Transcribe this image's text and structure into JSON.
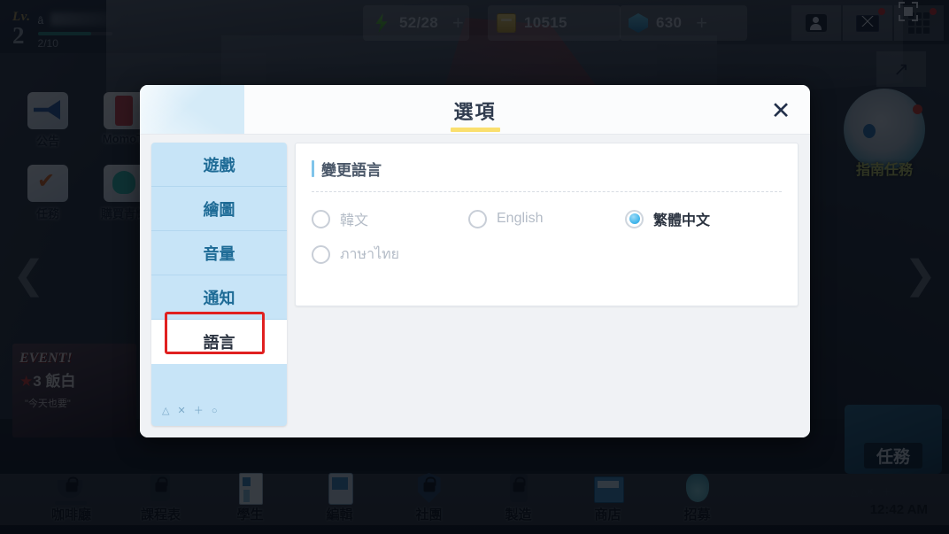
{
  "hud": {
    "level_label": "Lv.",
    "level_value": "2",
    "xp_text": "2/10",
    "currencies": [
      {
        "icon": "energy-icon",
        "value": "52/28",
        "plus": "+"
      },
      {
        "icon": "coin-icon",
        "value": "10515",
        "plus": ""
      },
      {
        "icon": "gem-icon",
        "value": "630",
        "plus": "+"
      }
    ],
    "right_buttons": [
      {
        "name": "friends-icon"
      },
      {
        "name": "mail-icon"
      },
      {
        "name": "menu-grid-icon"
      }
    ],
    "expand_icon": "↗"
  },
  "side_menu": {
    "items": [
      {
        "label": "公告",
        "icon": "announcement-icon"
      },
      {
        "label": "MomoT.",
        "icon": "momotalk-icon"
      },
      {
        "label": "任務",
        "icon": "mission-icon"
      },
      {
        "label": "購買青輝",
        "icon": "shop-pyroxene-icon"
      }
    ]
  },
  "character": {
    "label": "指南任務"
  },
  "nav": {
    "left_arrow": "❮",
    "right_arrow": "❯"
  },
  "event_banner": {
    "title": "EVENT!",
    "star": "★",
    "subtitle": "3 飯白",
    "small": "\"今天也要\""
  },
  "task_button": {
    "label": "任務"
  },
  "bottom_nav": {
    "items": [
      {
        "label": "咖啡廳",
        "icon": "cafe-icon",
        "locked": true
      },
      {
        "label": "課程表",
        "icon": "schedule-icon",
        "locked": true
      },
      {
        "label": "學生",
        "icon": "students-icon",
        "locked": false
      },
      {
        "label": "編輯",
        "icon": "edit-icon",
        "locked": false
      },
      {
        "label": "社團",
        "icon": "club-icon",
        "locked": true
      },
      {
        "label": "製造",
        "icon": "craft-icon",
        "locked": true
      },
      {
        "label": "商店",
        "icon": "shop-icon",
        "locked": false
      },
      {
        "label": "招募",
        "icon": "recruit-icon",
        "locked": false
      }
    ],
    "ps_glyphs": "△ ✕ ＋ ○",
    "clock": "12:42 AM"
  },
  "dialog": {
    "title": "選項",
    "close_label": "✕",
    "tabs": [
      {
        "label": "遊戲",
        "active": false
      },
      {
        "label": "繪圖",
        "active": false
      },
      {
        "label": "音量",
        "active": false
      },
      {
        "label": "通知",
        "active": false
      },
      {
        "label": "語言",
        "active": true
      }
    ],
    "tabs_ps_glyphs": "△ ✕ ＋ ○",
    "language_section": {
      "heading": "變更語言",
      "options": [
        {
          "label": "韓文",
          "selected": false
        },
        {
          "label": "English",
          "selected": false
        },
        {
          "label": "繁體中文",
          "selected": true
        },
        {
          "label": "ภาษาไทย",
          "selected": false
        }
      ]
    }
  },
  "colors": {
    "accent_blue": "#4fb8ec",
    "tab_blue": "#c7e4f7",
    "tab_text": "#1e6b96",
    "highlight_red": "#e02020",
    "title_underline": "#fadf6e"
  }
}
